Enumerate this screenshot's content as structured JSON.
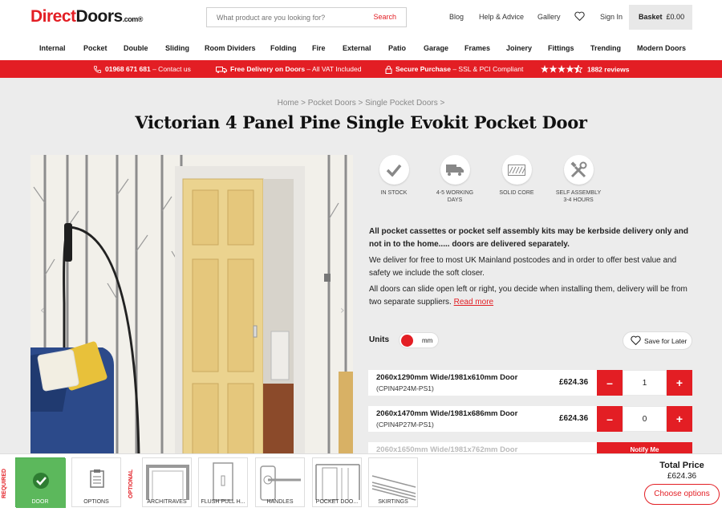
{
  "header": {
    "logo": {
      "part1": "Direct",
      "part2": "Doors",
      "part3": ".com®"
    },
    "search_placeholder": "What product are you looking for?",
    "search_button": "Search",
    "links": [
      "Blog",
      "Help & Advice",
      "Gallery",
      "Sign In"
    ],
    "basket_label": "Basket",
    "basket_amount": "£0.00"
  },
  "nav": [
    "Internal",
    "Pocket",
    "Double",
    "Sliding",
    "Room Dividers",
    "Folding",
    "Fire",
    "External",
    "Patio",
    "Garage",
    "Frames",
    "Joinery",
    "Fittings",
    "Trending",
    "Modern Doors"
  ],
  "banner": {
    "phone_bold": "01968 671 681",
    "phone_rest": " – Contact us",
    "delivery_bold": "Free Delivery on Doors",
    "delivery_rest": " – All VAT Included",
    "secure_bold": "Secure Purchase",
    "secure_rest": " – SSL & PCI Compliant",
    "reviews": "1882 reviews",
    "stars": 4.5
  },
  "breadcrumb": "Home > Pocket Doors > Single Pocket Doors >",
  "page_title": "Victorian 4 Panel Pine Single Evokit Pocket Door",
  "features": [
    {
      "label1": "IN STOCK",
      "label2": "",
      "icon": "check-icon"
    },
    {
      "label1": "4-5 WORKING",
      "label2": "DAYS",
      "icon": "truck-icon"
    },
    {
      "label1": "SOLID CORE",
      "label2": "",
      "icon": "core-icon"
    },
    {
      "label1": "SELF ASSEMBLY",
      "label2": "3-4 HOURS",
      "icon": "tools-icon"
    }
  ],
  "description": {
    "p1": "All pocket cassettes or pocket self assembly kits may be kerbside delivery only and not in to the home..... doors are delivered separately.",
    "p2": "We deliver for free to most UK Mainland postcodes and in order to offer best value and safety we include the soft closer.",
    "p3": "All doors can slide open left or right, you decide when installing them, delivery will be from two separate suppliers.",
    "read_more": "Read more"
  },
  "units": {
    "label": "Units",
    "value": "mm"
  },
  "save_later": "Save for Later",
  "products": [
    {
      "name": "2060x1290mm Wide/1981x610mm Door",
      "code": "(CPIN4P24M-PS1)",
      "price": "£624.36",
      "qty": "1"
    },
    {
      "name": "2060x1470mm Wide/1981x686mm Door",
      "code": "(CPIN4P27M-PS1)",
      "price": "£624.36",
      "qty": "0"
    },
    {
      "name": "2060x1650mm Wide/1981x762mm Door",
      "notify": "Notify Me"
    }
  ],
  "bottom": {
    "required_label": "REQUIRED",
    "optional_label": "OPTIONAL",
    "thumbs": [
      "DOOR",
      "OPTIONS",
      "ARCHITRAVES",
      "FLUSH PULL H...",
      "HANDLES",
      "POCKET DOO...",
      "SKIRTINGS"
    ],
    "total_label": "Total Price",
    "total_value": "£624.36",
    "choose_button": "Choose options"
  },
  "colors": {
    "brand_red": "#e31e24",
    "door_green": "#4caf50"
  }
}
